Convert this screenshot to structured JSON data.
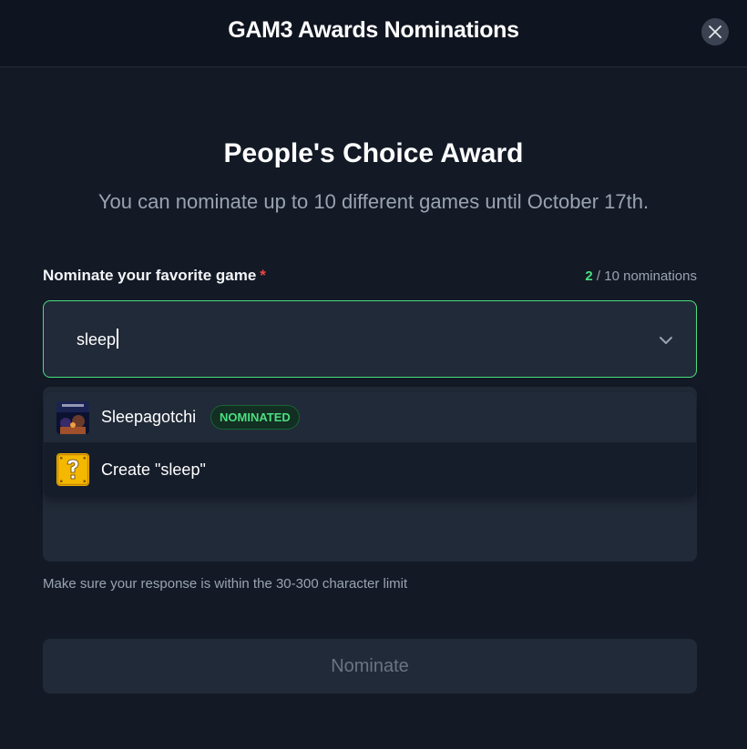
{
  "header": {
    "title": "GAM3 Awards Nominations",
    "close_icon": "close-icon"
  },
  "award": {
    "title": "People's Choice Award",
    "subtitle": "You can nominate up to 10 different games until October 17th."
  },
  "field": {
    "label": "Nominate your favorite game",
    "required_mark": "*",
    "counter_current": "2",
    "counter_rest": " / 10 nominations",
    "value": "sleep"
  },
  "dropdown": {
    "options": [
      {
        "label": "Sleepagotchi",
        "badge": "NOMINATED",
        "icon": "game-thumbnail"
      },
      {
        "label": "Create \"sleep\"",
        "icon": "question-block-icon"
      }
    ]
  },
  "hint": "Make sure your response is within the 30-300 character limit",
  "submit_label": "Nominate",
  "colors": {
    "accent": "#4ade80",
    "required": "#ef4444",
    "background": "#131a26",
    "surface": "#212a38"
  }
}
